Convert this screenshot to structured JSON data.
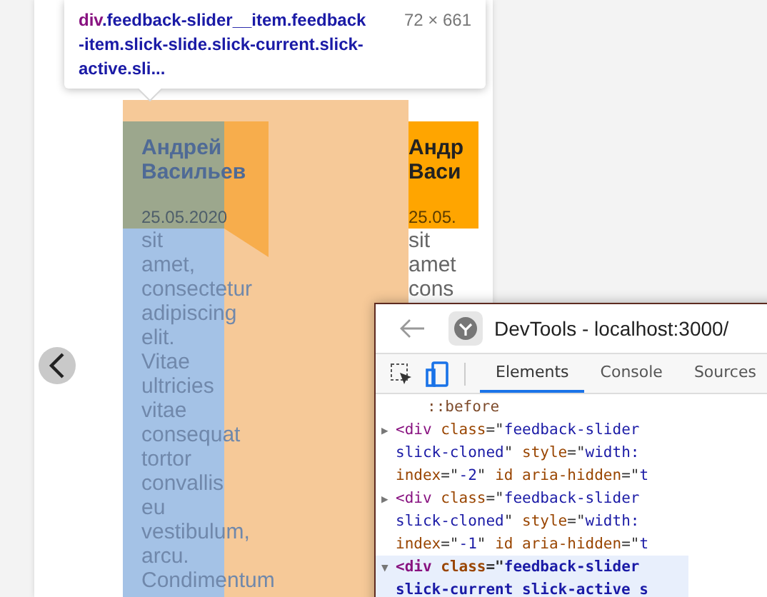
{
  "tooltip": {
    "tag": "div",
    "selector": ".feedback-slider__item.feedback-item.slick-slide.slick-current.slick-active.sli...",
    "size": "72 × 661"
  },
  "slides": [
    {
      "highlighted": true,
      "name_lines": [
        "Андрей",
        "Васильев"
      ],
      "date": "25.05.2020",
      "body_lines": [
        "sit",
        "amet,",
        "consectetur",
        "adipiscing",
        "elit.",
        "Vitae",
        "ultricies",
        "vitae",
        "consequat",
        "tortor",
        "convallis",
        "eu",
        "vestibulum,",
        "arcu.",
        "Condimentum"
      ]
    },
    {
      "highlighted": false,
      "name_lines": [
        "Андр",
        "Васи"
      ],
      "date": "25.05.",
      "body_lines": [
        "sit",
        "amet",
        "cons"
      ]
    }
  ],
  "devtools": {
    "title": "DevTools - localhost:3000/",
    "tabs": [
      {
        "label": "Elements",
        "selected": true
      },
      {
        "label": "Console",
        "selected": false
      },
      {
        "label": "Sources",
        "selected": false
      }
    ],
    "lines": [
      {
        "kind": "pseudo",
        "selected": false,
        "segments": [
          {
            "kind": "pseudo",
            "text": "::before"
          }
        ]
      },
      {
        "kind": "open",
        "selected": false,
        "marker": "▶",
        "segments": [
          {
            "kind": "tag",
            "text": "<div"
          },
          {
            "kind": "attr",
            "text": " class"
          },
          {
            "kind": "plain",
            "text": "=\""
          },
          {
            "kind": "value",
            "text": "feedback-slider"
          }
        ]
      },
      {
        "kind": "cont",
        "selected": false,
        "segments": [
          {
            "kind": "value",
            "text": "slick-cloned"
          },
          {
            "kind": "plain",
            "text": "\""
          },
          {
            "kind": "attr",
            "text": " style"
          },
          {
            "kind": "plain",
            "text": "=\""
          },
          {
            "kind": "value",
            "text": "width:"
          }
        ]
      },
      {
        "kind": "cont",
        "selected": false,
        "segments": [
          {
            "kind": "attr",
            "text": "index"
          },
          {
            "kind": "plain",
            "text": "=\""
          },
          {
            "kind": "value",
            "text": "-2"
          },
          {
            "kind": "plain",
            "text": "\""
          },
          {
            "kind": "attr",
            "text": " id aria-hidden"
          },
          {
            "kind": "plain",
            "text": "=\""
          },
          {
            "kind": "value",
            "text": "t"
          }
        ]
      },
      {
        "kind": "open",
        "selected": false,
        "marker": "▶",
        "segments": [
          {
            "kind": "tag",
            "text": "<div"
          },
          {
            "kind": "attr",
            "text": " class"
          },
          {
            "kind": "plain",
            "text": "=\""
          },
          {
            "kind": "value",
            "text": "feedback-slider"
          }
        ]
      },
      {
        "kind": "cont",
        "selected": false,
        "segments": [
          {
            "kind": "value",
            "text": "slick-cloned"
          },
          {
            "kind": "plain",
            "text": "\""
          },
          {
            "kind": "attr",
            "text": " style"
          },
          {
            "kind": "plain",
            "text": "=\""
          },
          {
            "kind": "value",
            "text": "width:"
          }
        ]
      },
      {
        "kind": "cont",
        "selected": false,
        "segments": [
          {
            "kind": "attr",
            "text": "index"
          },
          {
            "kind": "plain",
            "text": "=\""
          },
          {
            "kind": "value",
            "text": "-1"
          },
          {
            "kind": "plain",
            "text": "\""
          },
          {
            "kind": "attr",
            "text": " id aria-hidden"
          },
          {
            "kind": "plain",
            "text": "=\""
          },
          {
            "kind": "value",
            "text": "t"
          }
        ]
      },
      {
        "kind": "open",
        "selected": true,
        "marker": "▼",
        "segments": [
          {
            "kind": "tag",
            "text": "<div"
          },
          {
            "kind": "attr",
            "text": " class"
          },
          {
            "kind": "plain",
            "text": "=\""
          },
          {
            "kind": "value",
            "text": "feedback-slider"
          }
        ]
      },
      {
        "kind": "cont",
        "selected": true,
        "segments": [
          {
            "kind": "value",
            "text": "slick-current slick-active s"
          }
        ]
      }
    ]
  }
}
